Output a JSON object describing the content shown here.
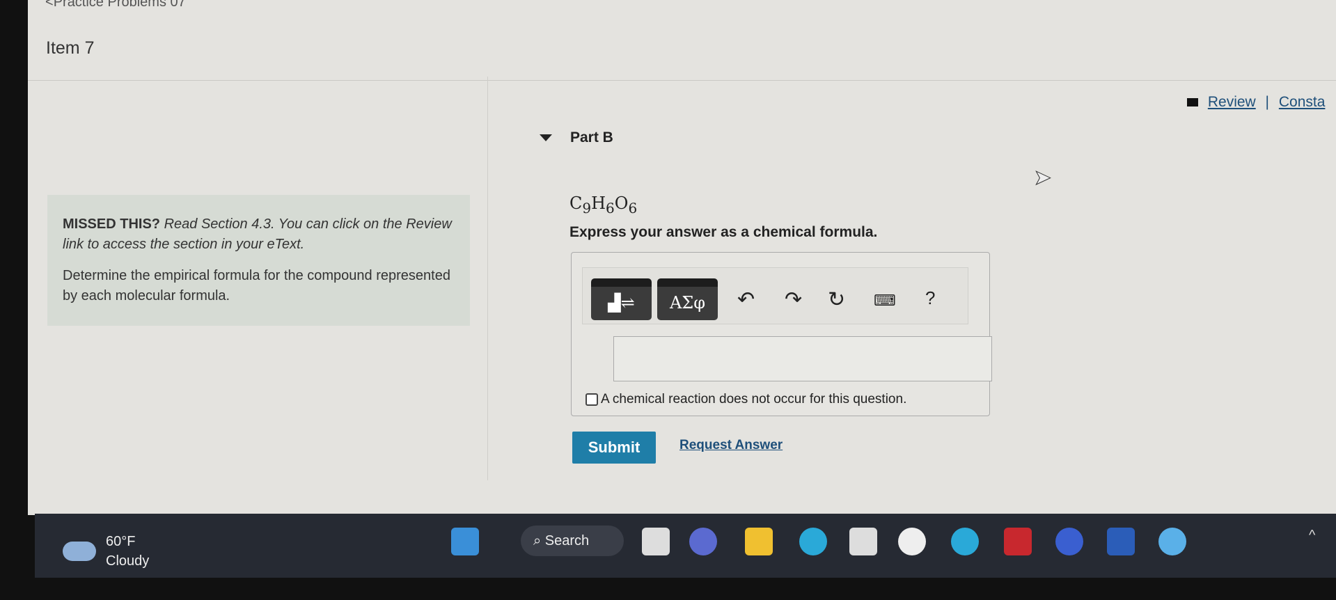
{
  "nav": {
    "back_label": "Practice Problems 07",
    "item_title": "Item 7"
  },
  "links": {
    "review": "Review",
    "separator": "|",
    "constants": "Consta"
  },
  "left_panel": {
    "missed_label": "MISSED THIS?",
    "missed_text": " Read Section 4.3. You can click on the Review link to access the section in your eText.",
    "instructions": "Determine the empirical formula for the compound represented by each molecular formula."
  },
  "part": {
    "title": "Part B",
    "formula": "C9H6O6",
    "formula_parts": [
      "C",
      "9",
      "H",
      "6",
      "O",
      "6"
    ],
    "prompt": "Express your answer as a chemical formula."
  },
  "toolbar": {
    "template_icon": "templates-icon",
    "symbols_label": "ΑΣφ",
    "undo_icon": "undo-icon",
    "redo_icon": "redo-icon",
    "reset_icon": "reset-icon",
    "keyboard_icon": "keyboard-icon",
    "help_label": "?"
  },
  "answer": {
    "value": "",
    "no_reaction_label": "A chemical reaction does not occur for this question.",
    "no_reaction_checked": false
  },
  "actions": {
    "submit": "Submit",
    "request_answer": "Request Answer"
  },
  "taskbar": {
    "temperature": "60°F",
    "condition": "Cloudy",
    "search": "Search"
  },
  "colors": {
    "submit_bg": "#1f7ea8",
    "link": "#1e4f7a"
  }
}
